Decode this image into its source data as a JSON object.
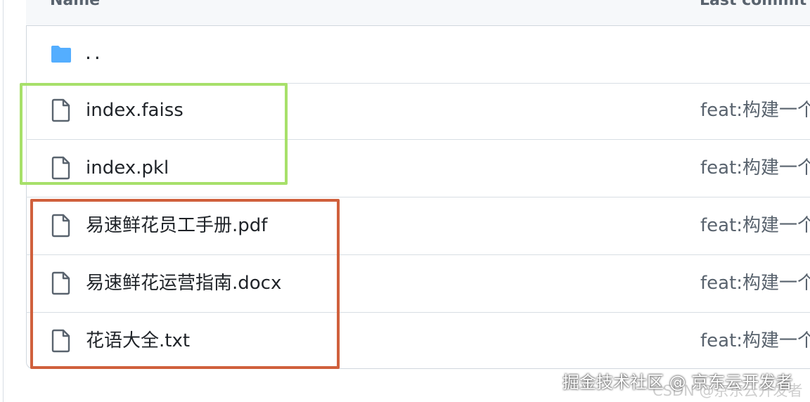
{
  "header": {
    "name_label": "Name",
    "commit_label": "Last commit m"
  },
  "rows": [
    {
      "type": "folder",
      "name": "..",
      "commit": ""
    },
    {
      "type": "file",
      "name": "index.faiss",
      "commit": "feat:构建一个"
    },
    {
      "type": "file",
      "name": "index.pkl",
      "commit": "feat:构建一个"
    },
    {
      "type": "file",
      "name": "易速鲜花员工手册.pdf",
      "commit": "feat:构建一个"
    },
    {
      "type": "file",
      "name": "易速鲜花运营指南.docx",
      "commit": "feat:构建一个"
    },
    {
      "type": "file",
      "name": "花语大全.txt",
      "commit": "feat:构建一个"
    }
  ],
  "icons": {
    "folder": "folder-icon",
    "file": "file-icon"
  },
  "colors": {
    "folder_blue": "#54aeff",
    "highlight_green": "#a7e06a",
    "highlight_red": "#d0603c"
  },
  "watermark": {
    "main": "掘金技术社区 @ 京东云开发者",
    "csdn": "CSDN @京东云开发者"
  }
}
